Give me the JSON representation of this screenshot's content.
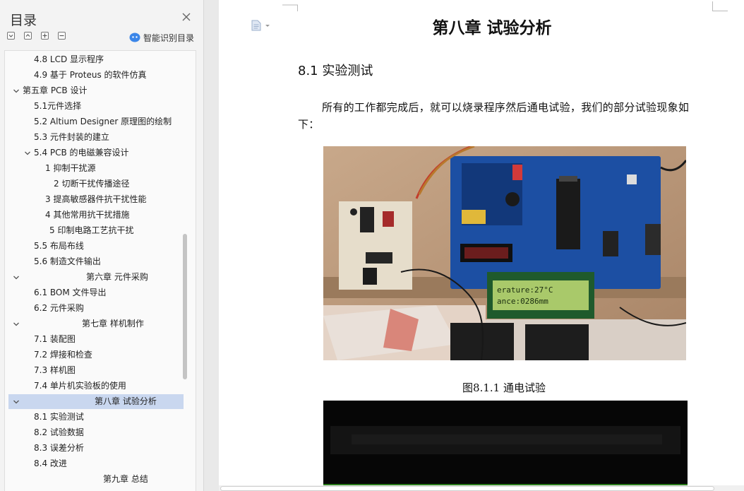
{
  "sidebar": {
    "title": "目录",
    "smart_toc_label": "智能识别目录",
    "items": [
      {
        "label": "4.8 LCD 显示程序"
      },
      {
        "label": "4.9  基于 Proteus 的软件仿真"
      },
      {
        "label": "第五章  PCB 设计"
      },
      {
        "label": "5.1元件选择"
      },
      {
        "label": "5.2 Altium Designer 原理图的绘制"
      },
      {
        "label": "5.3  元件封装的建立"
      },
      {
        "label": "5.4 PCB 的电磁兼容设计"
      },
      {
        "label": "1  抑制干扰源"
      },
      {
        "label": "2  切断干扰传播途径"
      },
      {
        "label": "3  提高敏感器件抗干扰性能"
      },
      {
        "label": "4  其他常用抗干扰措施"
      },
      {
        "label": "5  印制电路工艺抗干扰"
      },
      {
        "label": "5.5  布局布线"
      },
      {
        "label": "5.6  制造文件输出"
      },
      {
        "label": "第六章  元件采购"
      },
      {
        "label": "6.1 BOM  文件导出"
      },
      {
        "label": "6.2  元件采购"
      },
      {
        "label": "第七章  样机制作"
      },
      {
        "label": "7.1  装配图"
      },
      {
        "label": "7.2  焊接和检查"
      },
      {
        "label": "7.3  样机图"
      },
      {
        "label": "7.4  单片机实验板的使用"
      },
      {
        "label": "第八章  试验分析"
      },
      {
        "label": "8.1  实验测试"
      },
      {
        "label": "8.2  试验数据"
      },
      {
        "label": "8.3  误差分析"
      },
      {
        "label": "8.4  改进"
      },
      {
        "label": "第九章  总结"
      }
    ]
  },
  "document": {
    "chapter_title": "第八章  试验分析",
    "section_title": "8.1  实验测试",
    "paragraph": "所有的工作都完成后，就可以烧录程序然后通电试验，我们的部分试验现象如下：",
    "figure_caption": "图8.1.1  通电试验",
    "lcd_line1": "erature:27°C",
    "lcd_line2": "ance:0286mm"
  },
  "colors": {
    "sidebar_bg": "#f3f3f3",
    "selected_bg": "#c9d7ef",
    "page_bg": "#ffffff",
    "app_bg": "#e9e9e9",
    "board_blue": "#1c4fa3",
    "lcd_green": "#a9c96a"
  },
  "icons": {
    "close": "close-icon",
    "collapse_all": "collapse-all-icon",
    "expand_all": "expand-all-icon",
    "add": "add-heading-icon",
    "remove": "remove-heading-icon",
    "smart": "smart-toc-icon",
    "doc": "document-icon",
    "chevron": "chevron-down-icon"
  }
}
